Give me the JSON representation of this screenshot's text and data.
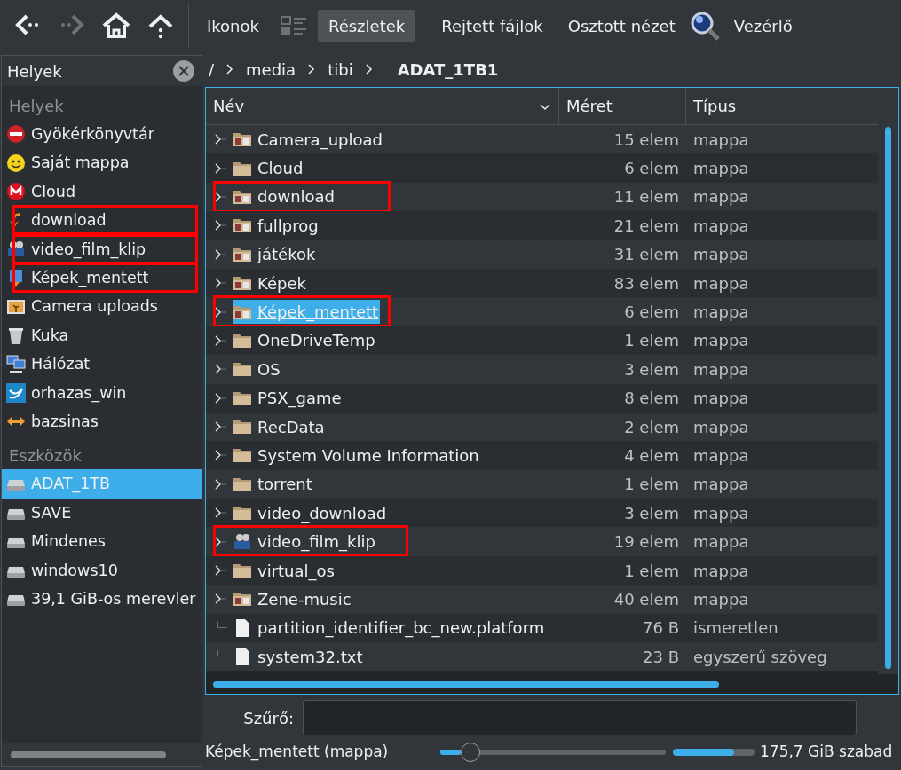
{
  "toolbar": [
    {
      "kind": "back",
      "disabled": false
    },
    {
      "kind": "forward",
      "disabled": true
    },
    {
      "kind": "home",
      "disabled": false
    },
    {
      "kind": "up",
      "disabled": false
    },
    {
      "kind": "separator"
    },
    {
      "kind": "text",
      "label": "Ikonok",
      "selected": false
    },
    {
      "kind": "compact",
      "disabled": true
    },
    {
      "kind": "text",
      "label": "Részletek",
      "selected": true
    },
    {
      "kind": "separator"
    },
    {
      "kind": "text",
      "label": "Rejtett fájlok",
      "selected": false
    },
    {
      "kind": "text",
      "label": "Osztott nézet",
      "selected": false
    },
    {
      "kind": "search"
    },
    {
      "kind": "text",
      "label": "Vezérlő",
      "selected": false
    }
  ],
  "sidebar": {
    "title": "Helyek",
    "sections": [
      {
        "heading": "Helyek",
        "items": [
          {
            "label": "Gyökérkönyvtár",
            "selected": false,
            "highlighted": false
          },
          {
            "label": "Saját mappa",
            "selected": false,
            "highlighted": false
          },
          {
            "label": "Cloud",
            "selected": false,
            "highlighted": false
          },
          {
            "label": "download",
            "selected": false,
            "highlighted": true
          },
          {
            "label": "video_film_klip",
            "selected": false,
            "highlighted": true
          },
          {
            "label": "Képek_mentett",
            "selected": false,
            "highlighted": true
          },
          {
            "label": "Camera uploads",
            "selected": false,
            "highlighted": false
          },
          {
            "label": "Kuka",
            "selected": false,
            "highlighted": false
          },
          {
            "label": "Hálózat",
            "selected": false,
            "highlighted": false
          },
          {
            "label": "orhazas_win",
            "selected": false,
            "highlighted": false
          },
          {
            "label": "bazsinas",
            "selected": false,
            "highlighted": false
          }
        ]
      },
      {
        "heading": "Eszközök",
        "items": [
          {
            "label": "ADAT_1TB",
            "selected": true,
            "highlighted": false
          },
          {
            "label": "SAVE",
            "selected": false,
            "highlighted": false
          },
          {
            "label": "Mindenes",
            "selected": false,
            "highlighted": false
          },
          {
            "label": "windows10",
            "selected": false,
            "highlighted": false
          },
          {
            "label": "39,1 GiB-os merevler",
            "selected": false,
            "highlighted": false
          }
        ]
      }
    ]
  },
  "breadcrumb": [
    {
      "label": "/",
      "current": false
    },
    {
      "label": "media",
      "current": false
    },
    {
      "label": "tibi",
      "current": false
    },
    {
      "label": "ADAT_1TB1",
      "current": true
    }
  ],
  "table": {
    "columns": [
      "Név",
      "Méret",
      "Típus"
    ],
    "rows": [
      {
        "kind": "picture-folder",
        "name": "Camera_upload",
        "size": "15 elem",
        "type": "mappa",
        "has_children": true,
        "selected": false,
        "highlighted": false
      },
      {
        "kind": "folder",
        "name": "Cloud",
        "size": "6 elem",
        "type": "mappa",
        "has_children": true,
        "selected": false,
        "highlighted": false
      },
      {
        "kind": "picture-folder",
        "name": "download",
        "size": "11 elem",
        "type": "mappa",
        "has_children": true,
        "selected": false,
        "highlighted": true
      },
      {
        "kind": "picture-folder",
        "name": "fullprog",
        "size": "21 elem",
        "type": "mappa",
        "has_children": true,
        "selected": false,
        "highlighted": false
      },
      {
        "kind": "picture-folder",
        "name": "játékok",
        "size": "31 elem",
        "type": "mappa",
        "has_children": true,
        "selected": false,
        "highlighted": false
      },
      {
        "kind": "picture-folder",
        "name": "Képek",
        "size": "83 elem",
        "type": "mappa",
        "has_children": true,
        "selected": false,
        "highlighted": false
      },
      {
        "kind": "picture-folder",
        "name": "Képek_mentett",
        "size": "6 elem",
        "type": "mappa",
        "has_children": true,
        "selected": true,
        "highlighted": true
      },
      {
        "kind": "folder",
        "name": "OneDriveTemp",
        "size": "1 elem",
        "type": "mappa",
        "has_children": true,
        "selected": false,
        "highlighted": false
      },
      {
        "kind": "folder",
        "name": "OS",
        "size": "3 elem",
        "type": "mappa",
        "has_children": true,
        "selected": false,
        "highlighted": false
      },
      {
        "kind": "folder",
        "name": "PSX_game",
        "size": "8 elem",
        "type": "mappa",
        "has_children": true,
        "selected": false,
        "highlighted": false
      },
      {
        "kind": "folder",
        "name": "RecData",
        "size": "2 elem",
        "type": "mappa",
        "has_children": true,
        "selected": false,
        "highlighted": false
      },
      {
        "kind": "folder",
        "name": "System Volume Information",
        "size": "4 elem",
        "type": "mappa",
        "has_children": true,
        "selected": false,
        "highlighted": false
      },
      {
        "kind": "folder",
        "name": "torrent",
        "size": "1 elem",
        "type": "mappa",
        "has_children": true,
        "selected": false,
        "highlighted": false
      },
      {
        "kind": "folder",
        "name": "video_download",
        "size": "3 elem",
        "type": "mappa",
        "has_children": true,
        "selected": false,
        "highlighted": false
      },
      {
        "kind": "film-folder",
        "name": "video_film_klip",
        "size": "19 elem",
        "type": "mappa",
        "has_children": true,
        "selected": false,
        "highlighted": true
      },
      {
        "kind": "folder",
        "name": "virtual_os",
        "size": "1 elem",
        "type": "mappa",
        "has_children": true,
        "selected": false,
        "highlighted": false
      },
      {
        "kind": "picture-folder",
        "name": "Zene-music",
        "size": "40 elem",
        "type": "mappa",
        "has_children": true,
        "selected": false,
        "highlighted": false
      },
      {
        "kind": "file",
        "name": "partition_identifier_bc_new.platform",
        "size": "76 B",
        "type": "ismeretlen",
        "has_children": false,
        "selected": false,
        "highlighted": false
      },
      {
        "kind": "file",
        "name": "system32.txt",
        "size": "23 B",
        "type": "egyszerű szöveg",
        "has_children": false,
        "selected": false,
        "highlighted": false
      }
    ]
  },
  "filter": {
    "label": "Szűrő:"
  },
  "status_bar": {
    "text": "Képek_mentett (mappa)",
    "zoom": {
      "level": 0.09
    },
    "free_space": {
      "level": 0.75
    },
    "free_text": "175,7 GiB szabad"
  }
}
